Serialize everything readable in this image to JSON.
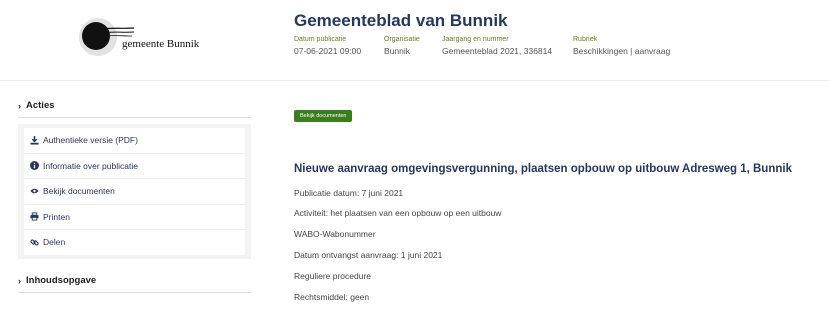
{
  "header": {
    "logo_text": "gemeente Bunnik",
    "title": "Gemeenteblad van Bunnik",
    "meta": [
      {
        "label": "Datum publicatie",
        "value": "07-06-2021 09:00"
      },
      {
        "label": "Organisatie",
        "value": "Bunnik"
      },
      {
        "label": "Jaargang en nummer",
        "value": "Gemeenteblad 2021, 336814"
      },
      {
        "label": "Rubriek",
        "value": "Beschikkingen | aanvraag"
      }
    ]
  },
  "sidebar": {
    "actions_heading": "Acties",
    "actions": [
      {
        "label": "Authentieke versie (PDF)",
        "icon": "download-icon"
      },
      {
        "label": "Informatie over publicatie",
        "icon": "info-icon"
      },
      {
        "label": "Bekijk documenten",
        "icon": "eye-icon"
      },
      {
        "label": "Printen",
        "icon": "print-icon"
      },
      {
        "label": "Delen",
        "icon": "share-icon"
      }
    ],
    "toc_heading": "Inhoudsopgave"
  },
  "main": {
    "documents_button": "Bekijk documenten",
    "title": "Nieuwe aanvraag omgevingsvergunning, plaatsen opbouw op uitbouw Adresweg 1, Bunnik",
    "paragraphs": [
      "Publicatie datum: 7 juni 2021",
      "Activiteit: het plaatsen van een opbouw op een uitbouw",
      "WABO-Wabonummer",
      "Datum ontvangst aanvraag: 1 juni 2021",
      "Reguliere procedure",
      "Rechtsmiddel: geen"
    ]
  },
  "colors": {
    "title": "#26385f",
    "meta_label": "#6b7d2a",
    "button": "#3a7d1f"
  }
}
